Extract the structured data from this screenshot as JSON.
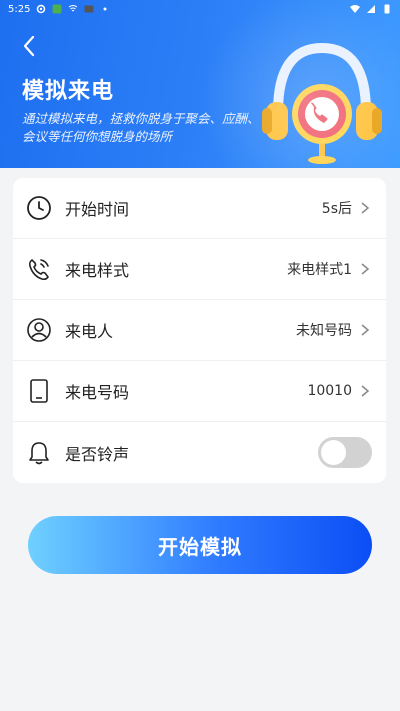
{
  "status_bar": {
    "time": "5:25"
  },
  "header": {
    "title": "模拟来电",
    "subtitle": "通过模拟来电，拯救你脱身于聚会、应酬、会议等任何你想脱身的场所"
  },
  "settings": {
    "rows": [
      {
        "label": "开始时间",
        "value": "5s后",
        "icon": "clock-icon"
      },
      {
        "label": "来电样式",
        "value": "来电样式1",
        "icon": "phone-call-icon"
      },
      {
        "label": "来电人",
        "value": "未知号码",
        "icon": "person-icon"
      },
      {
        "label": "来电号码",
        "value": "10010",
        "icon": "tablet-icon"
      },
      {
        "label": "是否铃声",
        "value": "",
        "icon": "bell-icon",
        "toggle": false
      }
    ]
  },
  "start_button": {
    "label": "开始模拟"
  },
  "colors": {
    "accent": "#2f7bff",
    "header": "#2d7ff7"
  }
}
